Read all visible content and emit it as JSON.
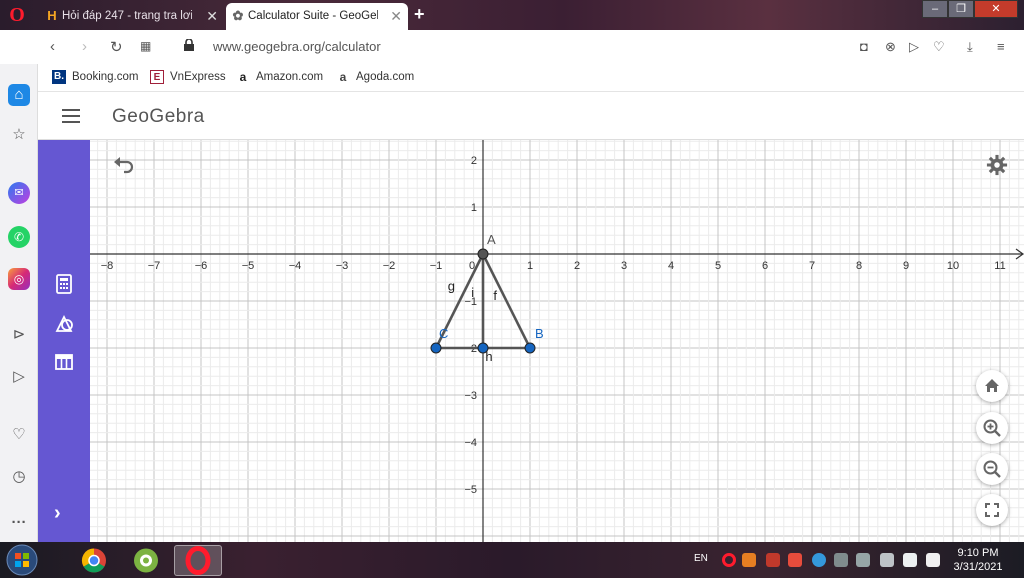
{
  "browser": {
    "tabs": [
      {
        "title": "Hỏi đáp 247 - trang tra lơi",
        "icon": "hoidap247-icon"
      },
      {
        "title": "Calculator Suite - GeoGebra",
        "icon": "geogebra-flower-icon"
      }
    ],
    "new_tab_label": "+",
    "url": "www.geogebra.org/calculator",
    "bookmarks": [
      {
        "label": "Booking.com",
        "icon": "B."
      },
      {
        "label": "VnExpress",
        "icon": "E"
      },
      {
        "label": "Amazon.com",
        "icon": "a"
      },
      {
        "label": "Agoda.com",
        "icon": "a"
      }
    ]
  },
  "app": {
    "logo": "GeoGebra",
    "tools": [
      "calculator-icon",
      "geometry-icon",
      "table-icon"
    ],
    "expand_label": "›"
  },
  "graph": {
    "x_ticks": [
      "−8",
      "−7",
      "−6",
      "−5",
      "−4",
      "−3",
      "−2",
      "−1",
      "0",
      "1",
      "2",
      "3",
      "4",
      "5",
      "6",
      "7",
      "8",
      "9",
      "10",
      "11"
    ],
    "y_ticks": [
      "2",
      "1",
      "−1",
      "−2",
      "−3",
      "−4",
      "−5"
    ],
    "points": [
      {
        "name": "A",
        "x": 0,
        "y": 0,
        "color": "#555555"
      },
      {
        "name": "B",
        "x": 1,
        "y": -2,
        "color": "#1565c0"
      },
      {
        "name": "C",
        "x": -1,
        "y": -2,
        "color": "#1565c0"
      },
      {
        "name": "",
        "x": 0,
        "y": -2,
        "color": "#1565c0"
      }
    ],
    "segments": [
      {
        "name": "f",
        "from": [
          0,
          0
        ],
        "to": [
          1,
          -2
        ]
      },
      {
        "name": "g",
        "from": [
          0,
          0
        ],
        "to": [
          -1,
          -2
        ]
      },
      {
        "name": "h",
        "from": [
          -1,
          -2
        ],
        "to": [
          1,
          -2
        ]
      },
      {
        "name": "i",
        "from": [
          0,
          0
        ],
        "to": [
          0,
          -2
        ]
      }
    ],
    "xlim": [
      -8,
      11
    ],
    "ylim": [
      -5,
      2
    ],
    "grid": true
  },
  "taskbar": {
    "lang": "EN",
    "time": "9:10 PM",
    "date": "3/31/2021"
  }
}
